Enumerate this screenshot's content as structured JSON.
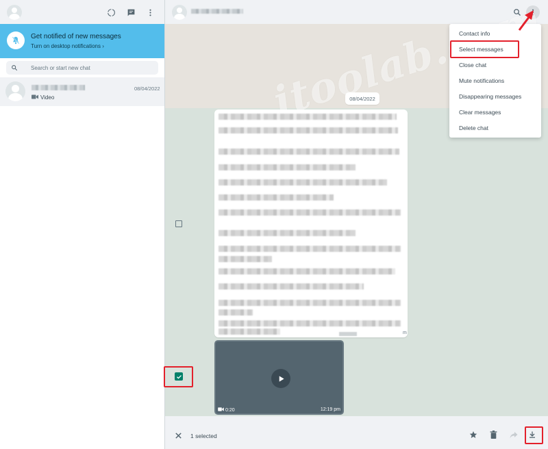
{
  "sidebar": {
    "notification": {
      "title": "Get notified of new messages",
      "subtitle": "Turn on desktop notifications ›"
    },
    "search": {
      "placeholder": "Search or start new chat"
    },
    "chat_item": {
      "date": "08/04/2022",
      "preview": "Video"
    }
  },
  "conversation": {
    "date_chip": "08/04/2022",
    "watermark": "itoolab.com",
    "text_message_time_suffix": "m",
    "video": {
      "duration": "0:20",
      "time": "12:19 pm"
    }
  },
  "menu": {
    "items": [
      "Contact info",
      "Select messages",
      "Close chat",
      "Mute notifications",
      "Disappearing messages",
      "Clear messages",
      "Delete chat"
    ]
  },
  "bottom_bar": {
    "selected_text": "1 selected"
  },
  "colors": {
    "notification_banner": "#53bdeb",
    "checkbox_checked": "#008069",
    "highlight_red": "#e3202b",
    "header_bg": "#f0f2f5"
  },
  "icons": {
    "sidebar_header": [
      "status-icon",
      "new-chat-icon",
      "menu-icon"
    ],
    "main_header": [
      "search-icon",
      "menu-icon"
    ],
    "bottom_bar": [
      "close-icon",
      "star-icon",
      "delete-icon",
      "forward-icon",
      "download-icon"
    ]
  }
}
